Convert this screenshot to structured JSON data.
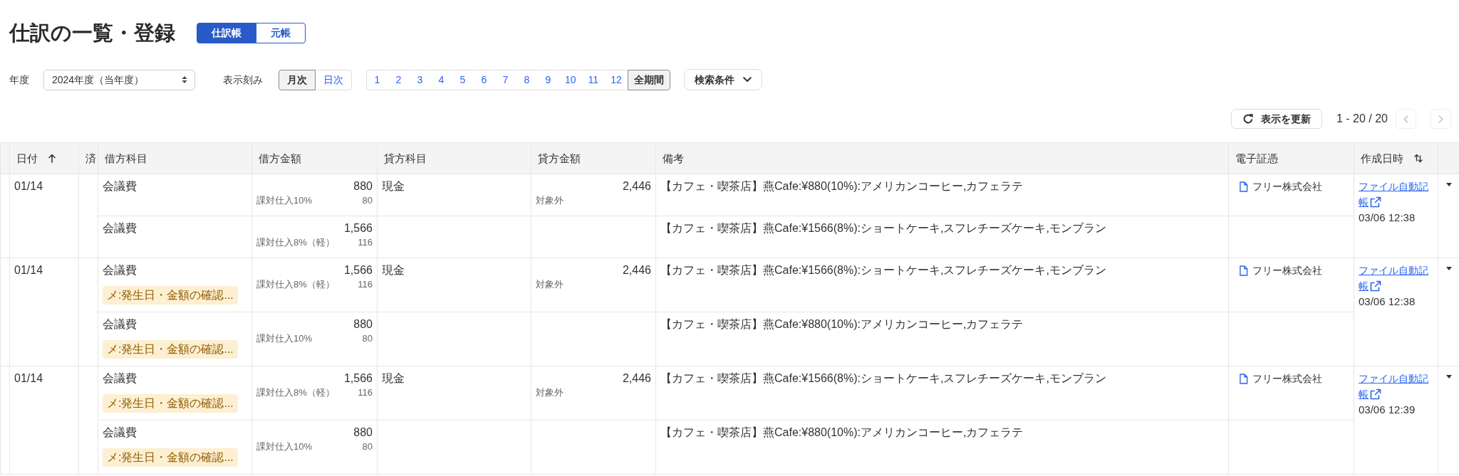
{
  "header": {
    "title": "仕訳の一覧・登録",
    "view_tabs": [
      {
        "label": "仕訳帳",
        "selected": true
      },
      {
        "label": "元帳",
        "selected": false
      }
    ]
  },
  "filters": {
    "fiscal_year": {
      "label": "年度",
      "value": "2024年度（当年度）"
    },
    "interval": {
      "label": "表示刻み",
      "options": [
        {
          "label": "月次",
          "selected": true
        },
        {
          "label": "日次",
          "selected": false
        }
      ]
    },
    "periods": [
      {
        "label": "1",
        "selected": false
      },
      {
        "label": "2",
        "selected": false
      },
      {
        "label": "3",
        "selected": false
      },
      {
        "label": "4",
        "selected": false
      },
      {
        "label": "5",
        "selected": false
      },
      {
        "label": "6",
        "selected": false
      },
      {
        "label": "7",
        "selected": false
      },
      {
        "label": "8",
        "selected": false
      },
      {
        "label": "9",
        "selected": false
      },
      {
        "label": "10",
        "selected": false
      },
      {
        "label": "11",
        "selected": false
      },
      {
        "label": "12",
        "selected": false
      },
      {
        "label": "全期間",
        "selected": true
      }
    ],
    "search_conditions": {
      "label": "検索条件"
    }
  },
  "toolbar": {
    "refresh_button": {
      "label": "表示を更新"
    },
    "range": "1 - 20 / 20",
    "previous_page": {
      "disabled": true
    },
    "next_page": {
      "disabled": true
    }
  },
  "table": {
    "columns": [
      {
        "label": "日付",
        "sortable": true,
        "sorted": true
      },
      {
        "label": "済",
        "sortable": false,
        "sorted": false
      },
      {
        "label": "借方科目",
        "sortable": false,
        "sorted": false
      },
      {
        "label": "借方金額",
        "sortable": false,
        "sorted": false
      },
      {
        "label": "貸方科目",
        "sortable": false,
        "sorted": false
      },
      {
        "label": "貸方金額",
        "sortable": false,
        "sorted": false
      },
      {
        "label": "備考",
        "sortable": false,
        "sorted": false
      },
      {
        "label": "電子証憑",
        "sortable": false,
        "sorted": false
      },
      {
        "label": "作成日時",
        "sortable": true,
        "sorted": false
      }
    ],
    "entries": [
      {
        "date": "01/14",
        "lines": [
          {
            "debit_account": "会議費",
            "debit_amount": "880",
            "debit_tax_category": "課対仕入10%",
            "debit_tax_amount": "80",
            "credit_account": "現金",
            "credit_amount": "2,446",
            "credit_tax_category": "対象外",
            "remarks": "【カフェ・喫茶店】燕Cafe:¥880(10%):アメリカンコーヒー,カフェラテ",
            "voucher": "フリー株式会社"
          },
          {
            "debit_account": "会議費",
            "debit_amount": "1,566",
            "debit_tax_category": "課対仕入8%（軽）",
            "debit_tax_amount": "116",
            "remarks": "【カフェ・喫茶店】燕Cafe:¥1566(8%):ショートケーキ,スフレチーズケーキ,モンブラン"
          }
        ],
        "created_by": "ファイル自動記帳",
        "created_at": "03/06 12:38"
      },
      {
        "date": "01/14",
        "lines": [
          {
            "debit_account": "会議費",
            "memo": "メ:発生日・金額の確認...",
            "debit_amount": "1,566",
            "debit_tax_category": "課対仕入8%（軽）",
            "debit_tax_amount": "116",
            "credit_account": "現金",
            "credit_amount": "2,446",
            "credit_tax_category": "対象外",
            "remarks": "【カフェ・喫茶店】燕Cafe:¥1566(8%):ショートケーキ,スフレチーズケーキ,モンブラン",
            "voucher": "フリー株式会社"
          },
          {
            "debit_account": "会議費",
            "memo": "メ:発生日・金額の確認...",
            "debit_amount": "880",
            "debit_tax_category": "課対仕入10%",
            "debit_tax_amount": "80",
            "remarks": "【カフェ・喫茶店】燕Cafe:¥880(10%):アメリカンコーヒー,カフェラテ"
          }
        ],
        "created_by": "ファイル自動記帳",
        "created_at": "03/06 12:38"
      },
      {
        "date": "01/14",
        "lines": [
          {
            "debit_account": "会議費",
            "memo": "メ:発生日・金額の確認...",
            "debit_amount": "1,566",
            "debit_tax_category": "課対仕入8%（軽）",
            "debit_tax_amount": "116",
            "credit_account": "現金",
            "credit_amount": "2,446",
            "credit_tax_category": "対象外",
            "remarks": "【カフェ・喫茶店】燕Cafe:¥1566(8%):ショートケーキ,スフレチーズケーキ,モンブラン",
            "voucher": "フリー株式会社"
          },
          {
            "debit_account": "会議費",
            "memo": "メ:発生日・金額の確認...",
            "debit_amount": "880",
            "debit_tax_category": "課対仕入10%",
            "debit_tax_amount": "80",
            "remarks": "【カフェ・喫茶店】燕Cafe:¥880(10%):アメリカンコーヒー,カフェラテ"
          }
        ],
        "created_by": "ファイル自動記帳",
        "created_at": "03/06 12:39"
      }
    ]
  }
}
